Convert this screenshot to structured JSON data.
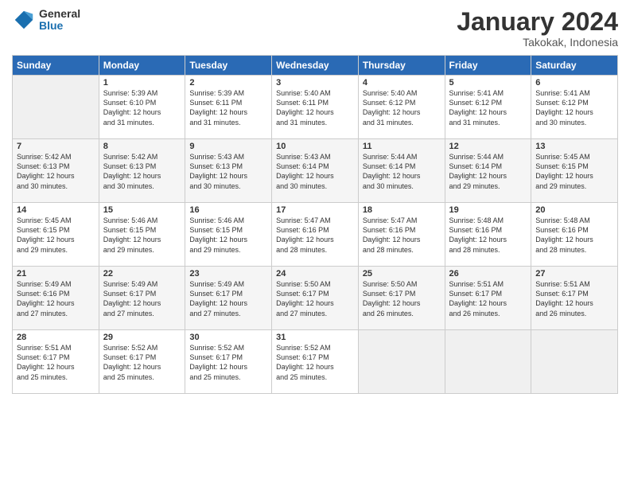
{
  "header": {
    "logo_general": "General",
    "logo_blue": "Blue",
    "month_title": "January 2024",
    "location": "Takokak, Indonesia"
  },
  "days_of_week": [
    "Sunday",
    "Monday",
    "Tuesday",
    "Wednesday",
    "Thursday",
    "Friday",
    "Saturday"
  ],
  "weeks": [
    [
      {
        "day": "",
        "info": ""
      },
      {
        "day": "1",
        "info": "Sunrise: 5:39 AM\nSunset: 6:10 PM\nDaylight: 12 hours\nand 31 minutes."
      },
      {
        "day": "2",
        "info": "Sunrise: 5:39 AM\nSunset: 6:11 PM\nDaylight: 12 hours\nand 31 minutes."
      },
      {
        "day": "3",
        "info": "Sunrise: 5:40 AM\nSunset: 6:11 PM\nDaylight: 12 hours\nand 31 minutes."
      },
      {
        "day": "4",
        "info": "Sunrise: 5:40 AM\nSunset: 6:12 PM\nDaylight: 12 hours\nand 31 minutes."
      },
      {
        "day": "5",
        "info": "Sunrise: 5:41 AM\nSunset: 6:12 PM\nDaylight: 12 hours\nand 31 minutes."
      },
      {
        "day": "6",
        "info": "Sunrise: 5:41 AM\nSunset: 6:12 PM\nDaylight: 12 hours\nand 30 minutes."
      }
    ],
    [
      {
        "day": "7",
        "info": "Sunrise: 5:42 AM\nSunset: 6:13 PM\nDaylight: 12 hours\nand 30 minutes."
      },
      {
        "day": "8",
        "info": "Sunrise: 5:42 AM\nSunset: 6:13 PM\nDaylight: 12 hours\nand 30 minutes."
      },
      {
        "day": "9",
        "info": "Sunrise: 5:43 AM\nSunset: 6:13 PM\nDaylight: 12 hours\nand 30 minutes."
      },
      {
        "day": "10",
        "info": "Sunrise: 5:43 AM\nSunset: 6:14 PM\nDaylight: 12 hours\nand 30 minutes."
      },
      {
        "day": "11",
        "info": "Sunrise: 5:44 AM\nSunset: 6:14 PM\nDaylight: 12 hours\nand 30 minutes."
      },
      {
        "day": "12",
        "info": "Sunrise: 5:44 AM\nSunset: 6:14 PM\nDaylight: 12 hours\nand 29 minutes."
      },
      {
        "day": "13",
        "info": "Sunrise: 5:45 AM\nSunset: 6:15 PM\nDaylight: 12 hours\nand 29 minutes."
      }
    ],
    [
      {
        "day": "14",
        "info": "Sunrise: 5:45 AM\nSunset: 6:15 PM\nDaylight: 12 hours\nand 29 minutes."
      },
      {
        "day": "15",
        "info": "Sunrise: 5:46 AM\nSunset: 6:15 PM\nDaylight: 12 hours\nand 29 minutes."
      },
      {
        "day": "16",
        "info": "Sunrise: 5:46 AM\nSunset: 6:15 PM\nDaylight: 12 hours\nand 29 minutes."
      },
      {
        "day": "17",
        "info": "Sunrise: 5:47 AM\nSunset: 6:16 PM\nDaylight: 12 hours\nand 28 minutes."
      },
      {
        "day": "18",
        "info": "Sunrise: 5:47 AM\nSunset: 6:16 PM\nDaylight: 12 hours\nand 28 minutes."
      },
      {
        "day": "19",
        "info": "Sunrise: 5:48 AM\nSunset: 6:16 PM\nDaylight: 12 hours\nand 28 minutes."
      },
      {
        "day": "20",
        "info": "Sunrise: 5:48 AM\nSunset: 6:16 PM\nDaylight: 12 hours\nand 28 minutes."
      }
    ],
    [
      {
        "day": "21",
        "info": "Sunrise: 5:49 AM\nSunset: 6:16 PM\nDaylight: 12 hours\nand 27 minutes."
      },
      {
        "day": "22",
        "info": "Sunrise: 5:49 AM\nSunset: 6:17 PM\nDaylight: 12 hours\nand 27 minutes."
      },
      {
        "day": "23",
        "info": "Sunrise: 5:49 AM\nSunset: 6:17 PM\nDaylight: 12 hours\nand 27 minutes."
      },
      {
        "day": "24",
        "info": "Sunrise: 5:50 AM\nSunset: 6:17 PM\nDaylight: 12 hours\nand 27 minutes."
      },
      {
        "day": "25",
        "info": "Sunrise: 5:50 AM\nSunset: 6:17 PM\nDaylight: 12 hours\nand 26 minutes."
      },
      {
        "day": "26",
        "info": "Sunrise: 5:51 AM\nSunset: 6:17 PM\nDaylight: 12 hours\nand 26 minutes."
      },
      {
        "day": "27",
        "info": "Sunrise: 5:51 AM\nSunset: 6:17 PM\nDaylight: 12 hours\nand 26 minutes."
      }
    ],
    [
      {
        "day": "28",
        "info": "Sunrise: 5:51 AM\nSunset: 6:17 PM\nDaylight: 12 hours\nand 25 minutes."
      },
      {
        "day": "29",
        "info": "Sunrise: 5:52 AM\nSunset: 6:17 PM\nDaylight: 12 hours\nand 25 minutes."
      },
      {
        "day": "30",
        "info": "Sunrise: 5:52 AM\nSunset: 6:17 PM\nDaylight: 12 hours\nand 25 minutes."
      },
      {
        "day": "31",
        "info": "Sunrise: 5:52 AM\nSunset: 6:17 PM\nDaylight: 12 hours\nand 25 minutes."
      },
      {
        "day": "",
        "info": ""
      },
      {
        "day": "",
        "info": ""
      },
      {
        "day": "",
        "info": ""
      }
    ]
  ]
}
